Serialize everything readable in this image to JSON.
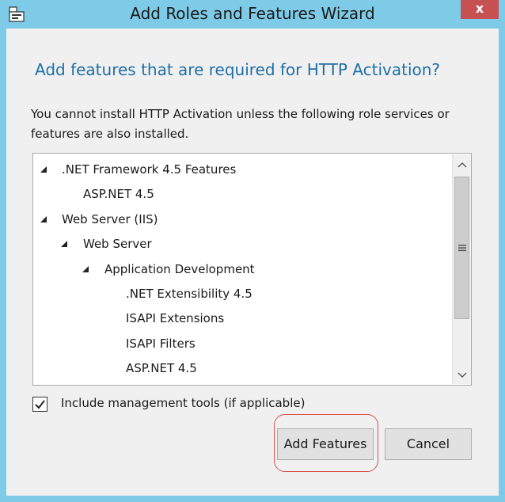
{
  "window": {
    "title": "Add Roles and Features Wizard",
    "close_label": "x",
    "accent_color": "#7ecbe8"
  },
  "dialog": {
    "heading": "Add features that are required for HTTP Activation?",
    "description": "You cannot install HTTP Activation unless the following role services or features are also installed.",
    "tree": [
      {
        "label": ".NET Framework 4.5 Features",
        "level": 0,
        "expanded": true
      },
      {
        "label": "ASP.NET 4.5",
        "level": 1,
        "expanded": null
      },
      {
        "label": "Web Server (IIS)",
        "level": 0,
        "expanded": true
      },
      {
        "label": "Web Server",
        "level": 1,
        "expanded": true
      },
      {
        "label": "Application Development",
        "level": 2,
        "expanded": true
      },
      {
        "label": ".NET Extensibility 4.5",
        "level": 3,
        "expanded": null
      },
      {
        "label": "ISAPI Extensions",
        "level": 3,
        "expanded": null
      },
      {
        "label": "ISAPI Filters",
        "level": 3,
        "expanded": null
      },
      {
        "label": "ASP.NET 4.5",
        "level": 3,
        "expanded": null
      }
    ],
    "include_tools": {
      "label": "Include management tools (if applicable)",
      "checked": true
    },
    "buttons": {
      "add_features": "Add Features",
      "cancel": "Cancel"
    }
  }
}
